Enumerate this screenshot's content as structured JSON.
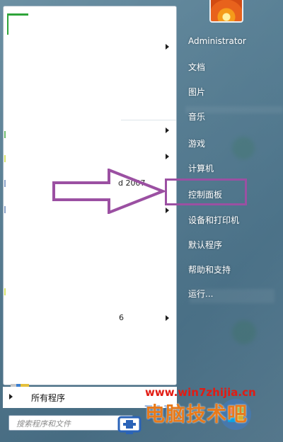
{
  "start_menu": {
    "left": {
      "partial_text_1": "d 2007",
      "partial_text_2": "6",
      "all_programs_label": "所有程序",
      "search_placeholder": "搜索程序和文件"
    },
    "right": {
      "username": "Administrator",
      "items": [
        {
          "label": "文档"
        },
        {
          "label": "图片"
        },
        {
          "label": "音乐"
        },
        {
          "label": "游戏"
        },
        {
          "label": "计算机"
        },
        {
          "label": "控制面板"
        },
        {
          "label": "设备和打印机"
        },
        {
          "label": "默认程序"
        },
        {
          "label": "帮助和支持"
        },
        {
          "label": "运行..."
        }
      ]
    }
  },
  "annotation": {
    "highlight_color": "#9b50a2",
    "highlighted_item": "控制面板"
  },
  "watermark": {
    "url": "www.win7zhijia.cn",
    "logo_text": "电脑技术吧",
    "url_color": "#e21b13",
    "logo_color": "#e87a1b"
  },
  "icons": [
    "user-picture-icon",
    "submenu-arrow-icon",
    "windows-orb-icon",
    "watermark-logo-icon"
  ]
}
